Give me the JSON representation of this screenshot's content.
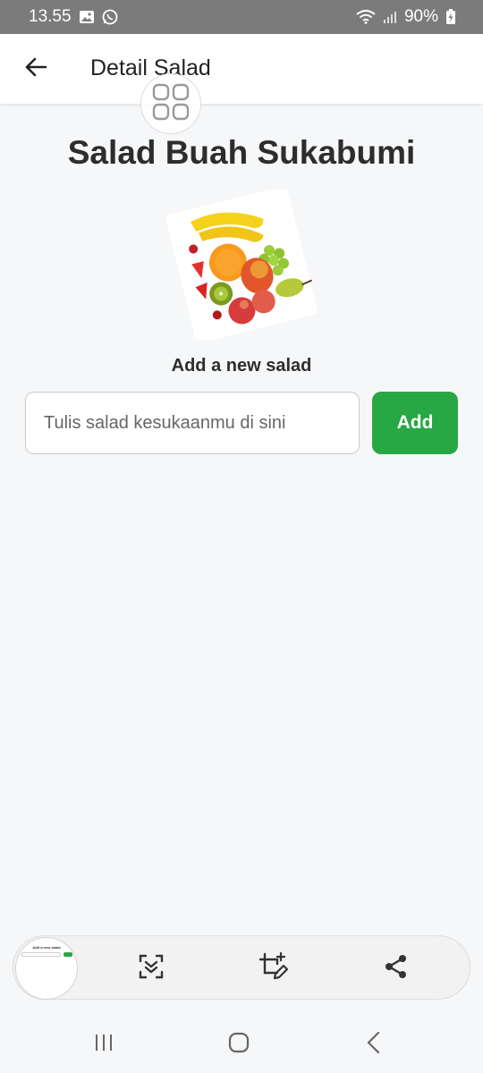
{
  "status": {
    "time": "13.55",
    "battery": "90%"
  },
  "app_bar": {
    "title": "Detail Salad"
  },
  "main": {
    "heading": "Salad Buah Sukabumi",
    "subheading": "Add a new salad",
    "input_placeholder": "Tulis salad kesukaanmu di sini",
    "input_value": "",
    "add_button": "Add"
  },
  "thumbnail": {
    "title": "Add a new salad"
  },
  "colors": {
    "accent": "#28a745",
    "background": "#f6f7f9",
    "status_bar": "#7b7b7b"
  }
}
